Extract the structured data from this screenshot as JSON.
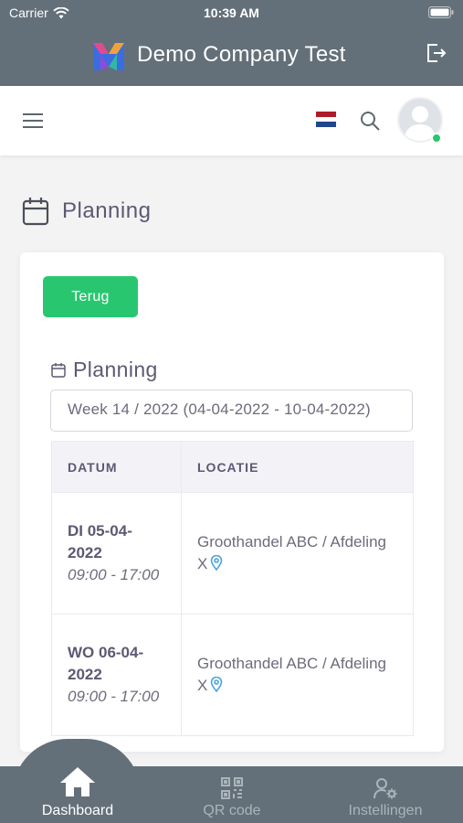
{
  "status": {
    "carrier": "Carrier",
    "time": "10:39 AM"
  },
  "app": {
    "title": "Demo Company Test"
  },
  "page": {
    "heading": "Planning"
  },
  "card": {
    "back_label": "Terug",
    "section_title": "Planning",
    "week_value": "Week 14 / 2022 (04-04-2022 - 10-04-2022)",
    "columns": [
      "DATUM",
      "LOCATIE"
    ],
    "rows": [
      {
        "date": "DI 05-04-2022",
        "time": "09:00 - 17:00",
        "location": "Groothandel ABC / Afdeling X"
      },
      {
        "date": "WO 06-04-2022",
        "time": "09:00 - 17:00",
        "location": "Groothandel ABC / Afdeling X"
      }
    ]
  },
  "bottom_nav": [
    {
      "label": "Dashboard",
      "icon": "home-icon",
      "active": true
    },
    {
      "label": "QR code",
      "icon": "qr-code-icon",
      "active": false
    },
    {
      "label": "Instellingen",
      "icon": "user-settings-icon",
      "active": false
    }
  ],
  "colors": {
    "topbar": "#647079",
    "accent_green": "#28c76f",
    "location_icon": "#4aa3df"
  }
}
